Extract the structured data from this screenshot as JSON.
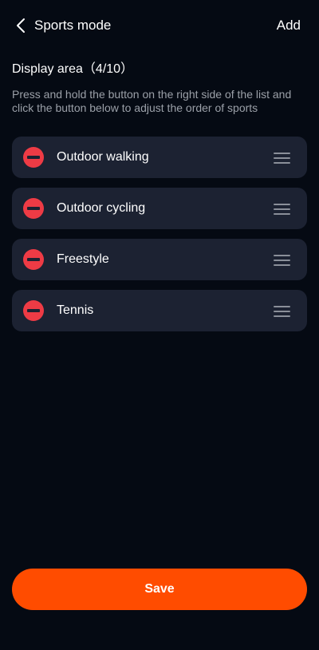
{
  "header": {
    "back_icon": "chevron-left-icon",
    "title": "Sports mode",
    "add_label": "Add"
  },
  "display_area": {
    "title": "Display area（4/10）",
    "hint": "Press and hold the button on the right side of the list and click the button below to adjust the order of sports"
  },
  "sports": [
    {
      "label": "Outdoor walking",
      "remove_icon": "minus-circle-icon",
      "drag_icon": "drag-handle-icon"
    },
    {
      "label": "Outdoor cycling",
      "remove_icon": "minus-circle-icon",
      "drag_icon": "drag-handle-icon"
    },
    {
      "label": "Freestyle",
      "remove_icon": "minus-circle-icon",
      "drag_icon": "drag-handle-icon"
    },
    {
      "label": "Tennis",
      "remove_icon": "minus-circle-icon",
      "drag_icon": "drag-handle-icon"
    }
  ],
  "save_label": "Save",
  "colors": {
    "background": "#050a13",
    "card": "#1c2232",
    "remove": "#ee3b45",
    "accent": "#ff4c00",
    "hint_text": "#9ba0a8"
  }
}
